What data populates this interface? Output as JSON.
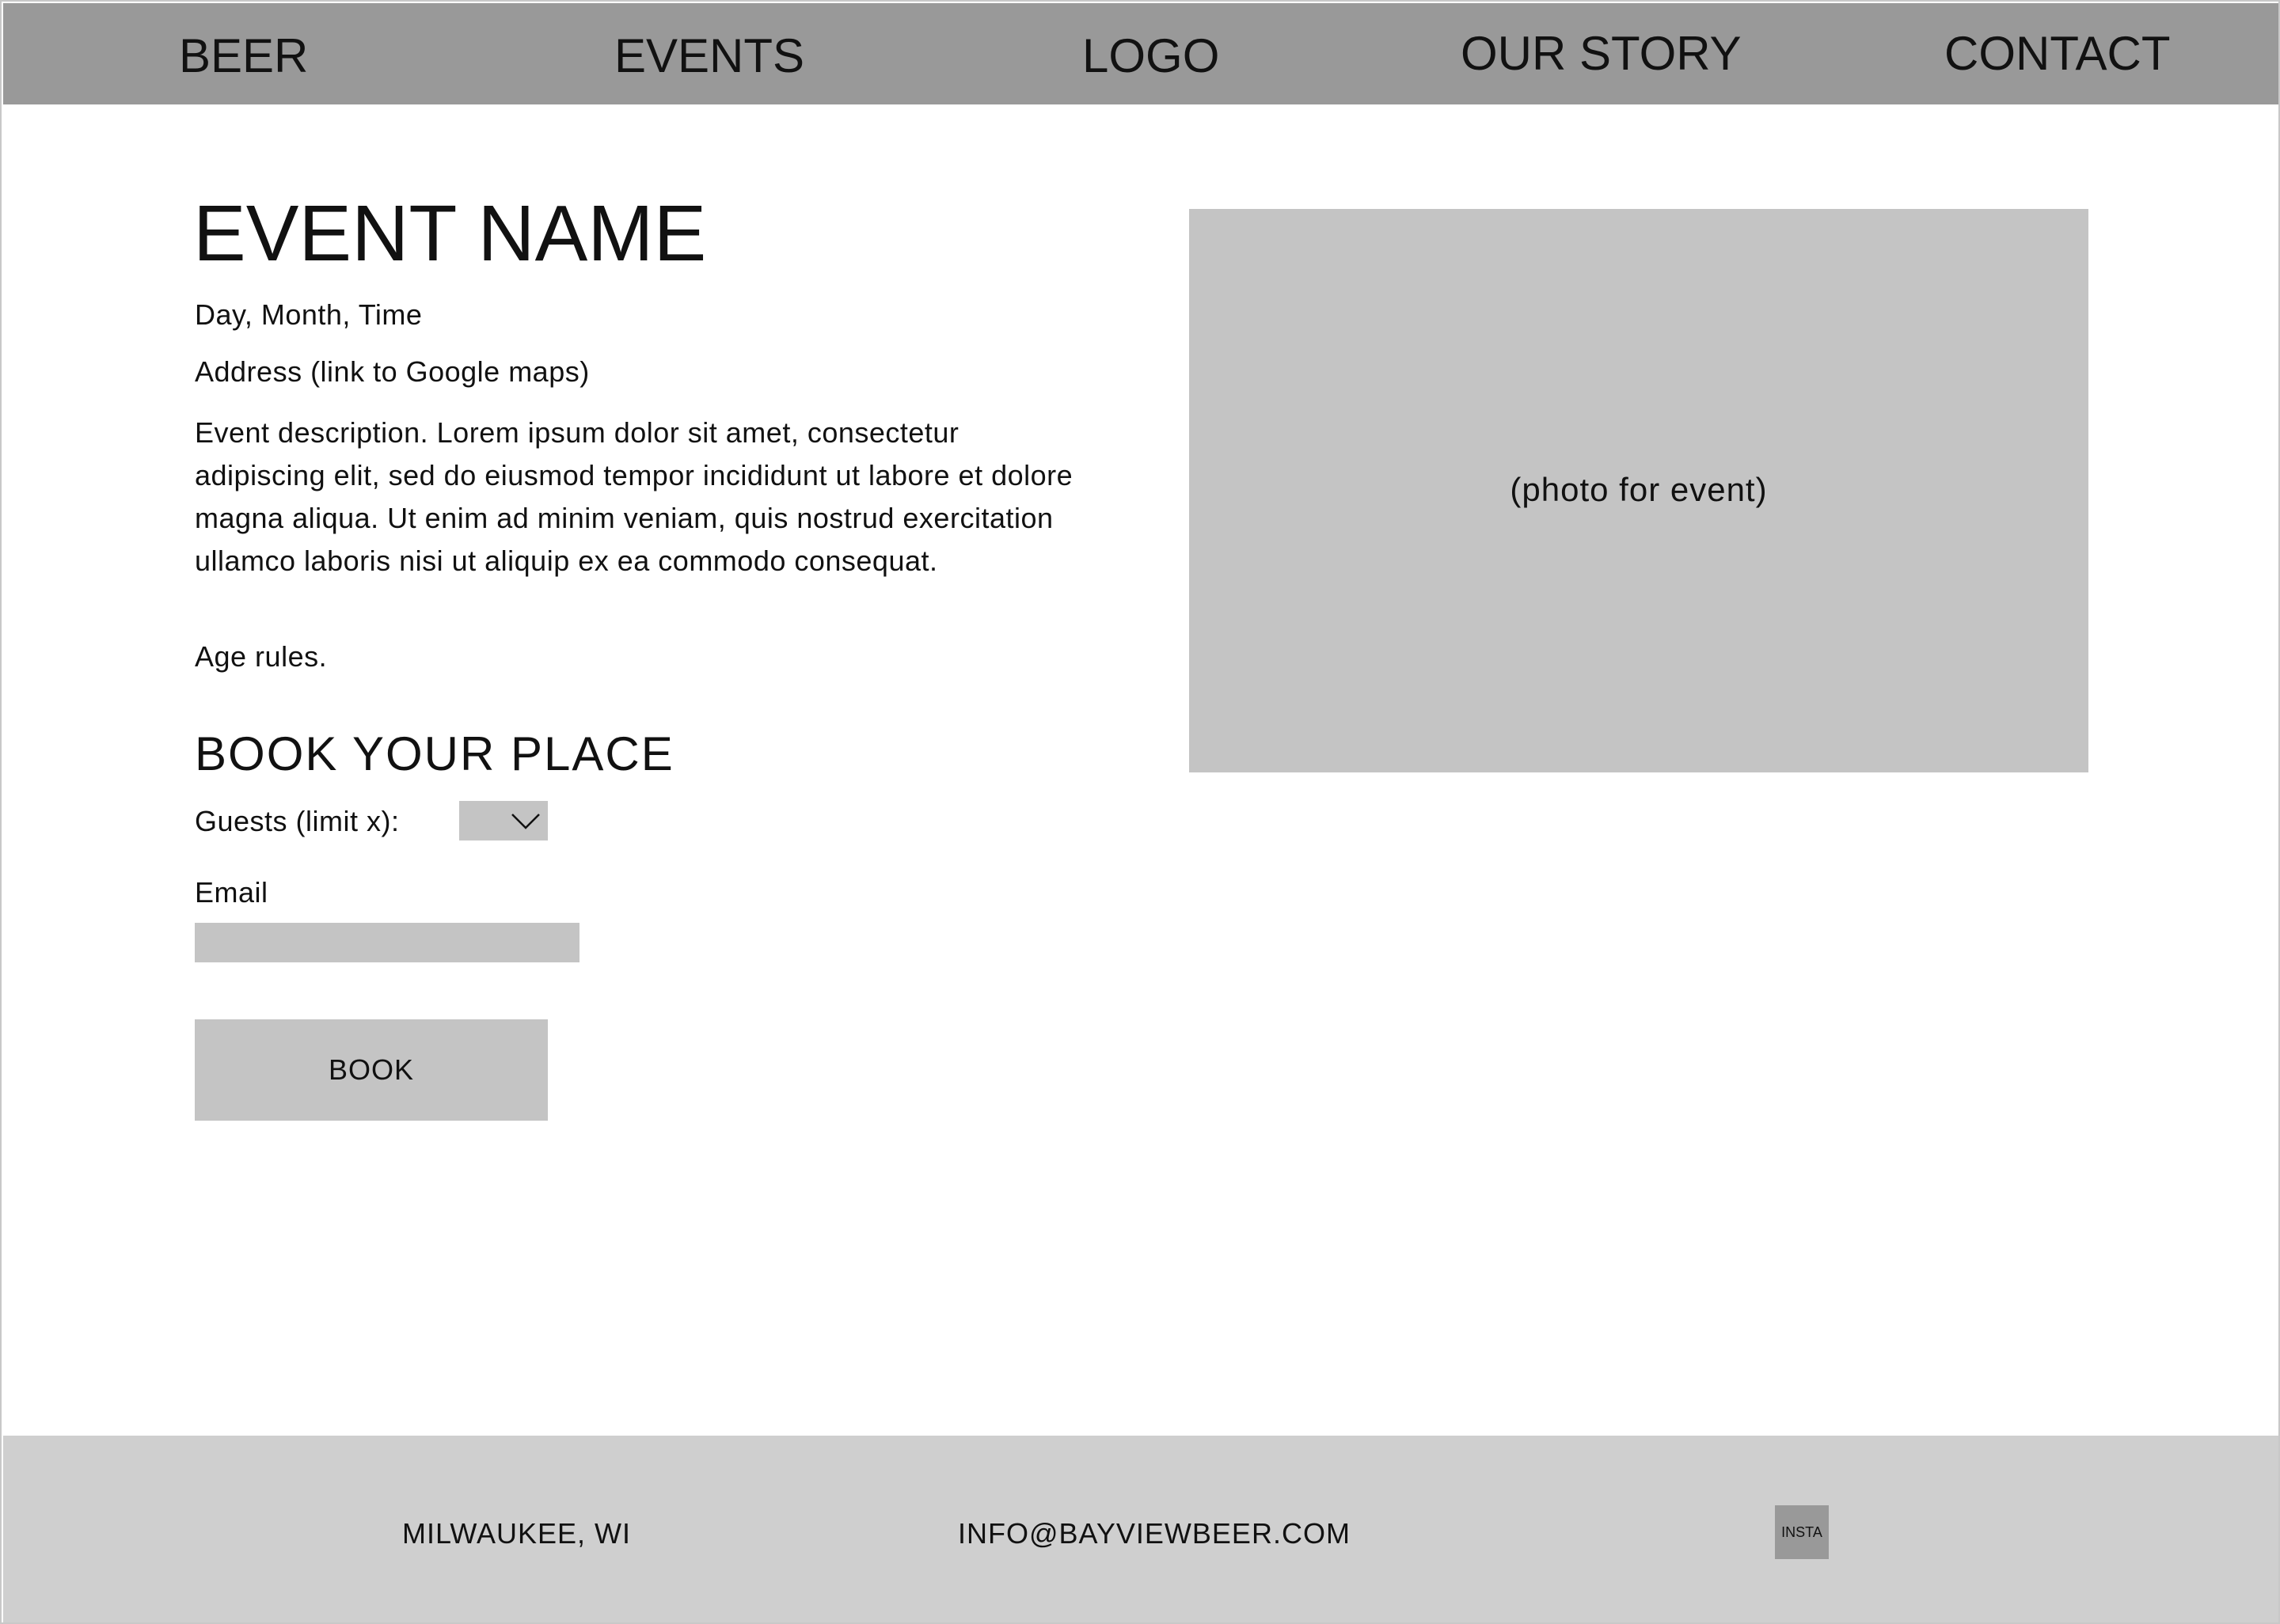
{
  "nav": {
    "beer": "BEER",
    "events": "EVENTS",
    "logo": "LOGO",
    "our_story": "OUR STORY",
    "contact": "CONTACT"
  },
  "event": {
    "title": "EVENT NAME",
    "datetime": "Day, Month, Time",
    "address": "Address (link to Google maps)",
    "description": "Event description. Lorem ipsum dolor sit amet, consectetur adipiscing elit, sed do eiusmod tempor incididunt ut labore et dolore magna aliqua. Ut enim ad minim veniam, quis nostrud exercitation ullamco laboris nisi ut aliquip ex ea commodo consequat.",
    "age_rules": "Age rules.",
    "photo_placeholder": "(photo for event)"
  },
  "booking": {
    "heading": "BOOK YOUR PLACE",
    "guests_label": "Guests (limit x):",
    "guests_value": "",
    "email_label": "Email",
    "email_value": "",
    "book_button": "BOOK"
  },
  "footer": {
    "location": "MILWAUKEE, WI",
    "email": "INFO@BAYVIEWBEER.COM",
    "insta": "INSTA"
  },
  "colors": {
    "nav_bg": "#999999",
    "placeholder_gray": "#c4c4c4",
    "footer_bg": "#cfcfcf",
    "text": "#111111"
  },
  "icons": {
    "guests_dropdown": "chevron-down-icon"
  }
}
